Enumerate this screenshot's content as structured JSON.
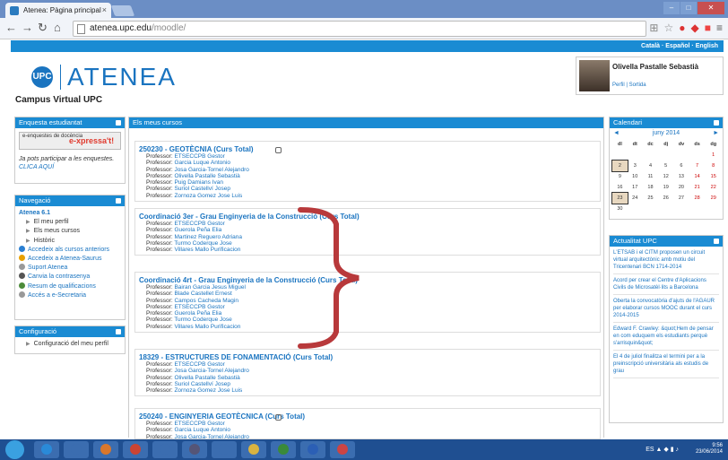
{
  "browser": {
    "tab_title": "Atenea: Pàgina principal",
    "tab_close": "×",
    "url_host": "atenea.upc.edu",
    "url_path": "/moodle/"
  },
  "lang": "Català · Español · English",
  "site": {
    "logo_text": "ATENEA",
    "logo_small": "UPC",
    "subtitle": "Campus Virtual UPC"
  },
  "user": {
    "name": "Olivella Pastalle Sebastià",
    "links": "Perfil | Sortida"
  },
  "survey": {
    "title": "Enquesta estudiantat",
    "banner_left": "e-enquestes de docència",
    "banner_right": "e-xpressa't!",
    "text": "Ja pots participar a les enquestes.",
    "cta": "CLICA AQUÍ"
  },
  "nav": {
    "title": "Navegació",
    "root": "Atenea 6.1",
    "items": [
      "El meu perfil",
      "Els meus cursos",
      "Històric"
    ],
    "links": [
      {
        "label": "Accedeix als cursos anteriors",
        "icon": "history-icon",
        "color": "#2a7fd2"
      },
      {
        "label": "Accedeix a Atenea-Saurus",
        "icon": "saurus-icon",
        "color": "#e8a000"
      },
      {
        "label": "Suport Atenea",
        "icon": "support-icon",
        "color": "#999999"
      },
      {
        "label": "Canvia la contrasenya",
        "icon": "key-icon",
        "color": "#555555"
      },
      {
        "label": "Resum de qualificacions",
        "icon": "grades-icon",
        "color": "#4c8b3a"
      },
      {
        "label": "Accés a e-Secretaria",
        "icon": "secretaria-icon",
        "color": "#999999"
      }
    ]
  },
  "config": {
    "title": "Configuració",
    "item": "Configuració del meu perfil"
  },
  "main": {
    "title": "Els meus cursos",
    "courses": [
      {
        "title": "250230 - GEOTÈCNIA (Curs Total)",
        "rows": [
          {
            "role": "Professor:",
            "name": "ETSECCPB Gestor"
          },
          {
            "role": "Professor:",
            "name": "Garcia Luque Antonio"
          },
          {
            "role": "Professor:",
            "name": "Josa Garcia-Tornel Alejandro"
          },
          {
            "role": "Professor:",
            "name": "Olivella Pastalle Sebastià"
          },
          {
            "role": "Professor:",
            "name": "Puig Damians Ivan"
          },
          {
            "role": "Professor:",
            "name": "Suriol Castellví Josep"
          },
          {
            "role": "Professor:",
            "name": "Zornoza Gomez Jose Luis"
          }
        ]
      },
      {
        "title": "Coordinació 3er - Grau Enginyeria de la Construcció (Curs Total)",
        "rows": [
          {
            "role": "Professor:",
            "name": "ETSECCPB Gestor"
          },
          {
            "role": "Professor:",
            "name": "Guerola Peña Elia"
          },
          {
            "role": "Professor:",
            "name": "Martinez Reguero Adriana"
          },
          {
            "role": "Professor:",
            "name": "Turmo Coderque Jose"
          },
          {
            "role": "Professor:",
            "name": "Villares Mallo Purificacion"
          }
        ]
      },
      {
        "title": "Coordinació 4rt - Grau Enginyeria de la Construcció (Curs Total)",
        "rows": [
          {
            "role": "Professor:",
            "name": "Bairan Garcia Jesus Miguel"
          },
          {
            "role": "Professor:",
            "name": "Blade Castellet Ernest"
          },
          {
            "role": "Professor:",
            "name": "Campos Cacheda Magin"
          },
          {
            "role": "Professor:",
            "name": "ETSECCPB Gestor"
          },
          {
            "role": "Professor:",
            "name": "Guerola Peña Elia"
          },
          {
            "role": "Professor:",
            "name": "Turmo Coderque Jose"
          },
          {
            "role": "Professor:",
            "name": "Villares Mallo Purificacion"
          }
        ]
      },
      {
        "title": "18329 - ESTRUCTURES DE FONAMENTACIÓ (Curs Total)",
        "rows": [
          {
            "role": "Professor:",
            "name": "ETSECCPB Gestor"
          },
          {
            "role": "Professor:",
            "name": "Josa Garcia-Tornel Alejandro"
          },
          {
            "role": "Professor:",
            "name": "Olivella Pastalle Sebastià"
          },
          {
            "role": "Professor:",
            "name": "Suriol Castellví Josep"
          },
          {
            "role": "Professor:",
            "name": "Zornoza Gomez Jose Luis"
          }
        ]
      },
      {
        "title": "250240 - ENGINYERIA GEOTÈCNICA (Curs Total)",
        "rows": [
          {
            "role": "Professor:",
            "name": "ETSECCPB Gestor"
          },
          {
            "role": "Professor:",
            "name": "Garcia Luque Antonio"
          },
          {
            "role": "Professor:",
            "name": "Josa Garcia-Tornel Alejandro"
          }
        ]
      }
    ]
  },
  "calendar": {
    "title": "Calendari",
    "month": "juny 2014",
    "prev": "◄",
    "next": "►",
    "days": [
      "dl",
      "dt",
      "dc",
      "dj",
      "dv",
      "ds",
      "dg"
    ],
    "weeks": [
      [
        "",
        "",
        "",
        "",
        "",
        "",
        "1"
      ],
      [
        "2",
        "3",
        "4",
        "5",
        "6",
        "7",
        "8"
      ],
      [
        "9",
        "10",
        "11",
        "12",
        "13",
        "14",
        "15"
      ],
      [
        "16",
        "17",
        "18",
        "19",
        "20",
        "21",
        "22"
      ],
      [
        "23",
        "24",
        "25",
        "26",
        "27",
        "28",
        "29"
      ],
      [
        "30",
        "",
        "",
        "",
        "",
        "",
        ""
      ]
    ],
    "highlighted": [
      "2",
      "23"
    ]
  },
  "news": {
    "title": "Actualitat UPC",
    "items": [
      "L'ETSAB i el CITM proposen un circuit virtual arquitectònic amb motiu del Tricentenari BCN 1714-2014",
      "Acord per crear el Centre d'Aplicacions Civils de Microsatèl·lits a Barcelona",
      "Oberta la convocatòria d'ajuts de l'AGAUR per elaborar cursos MOOC durant el curs 2014-2015",
      "Edward F. Crawley: &quot;Hem de pensar en com eduquem els estudiants perquè s'arrisquin&quot;",
      "El 4 de juliol finalitza el termini per a la preinscripció universitària als estudis de grau"
    ]
  },
  "taskbar": {
    "clock_time": "9:56",
    "clock_date": "23/06/2014",
    "tray_lang": "ES",
    "apps": [
      "IE",
      "Chrome",
      "Firefox",
      "Office",
      "Chrome",
      "GID",
      "Media",
      "Explorer",
      "Excel",
      "Word",
      "PowerPoint"
    ]
  }
}
